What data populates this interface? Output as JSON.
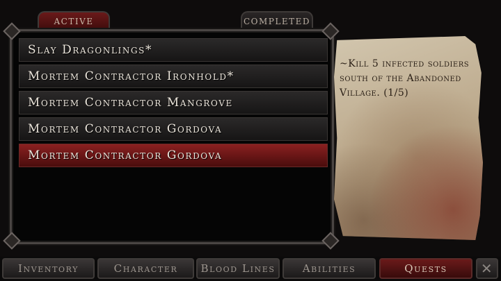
{
  "tabs": {
    "active": "Active",
    "completed": "Completed"
  },
  "quests": [
    "Slay Dragonlings*",
    "Mortem Contractor Ironhold*",
    "Mortem Contractor Mangrove",
    "Mortem Contractor Gordova",
    "Mortem Contractor Gordova"
  ],
  "selected_index": 4,
  "description": "~Kill 5 infected soldiers south of the Abandoned Village. (1/5)",
  "menu": {
    "inventory": "Inventory",
    "character": "Character",
    "blood_lines": "Blood Lines",
    "abilities": "Abilities",
    "quests": "Quests",
    "close": "✕"
  },
  "close_icon": "close-icon"
}
